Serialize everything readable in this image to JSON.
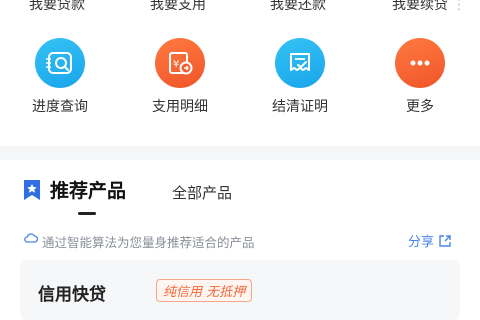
{
  "top_row": [
    "我要贷款",
    "我要支用",
    "我要还款",
    "我要续贷"
  ],
  "grid": [
    {
      "label": "进度查询",
      "icon": "progress-search-icon",
      "color": "#1fa9ee"
    },
    {
      "label": "支用明细",
      "icon": "bill-detail-icon",
      "color": "#f45e2f"
    },
    {
      "label": "结清证明",
      "icon": "settlement-certificate-icon",
      "color": "#1fa9ee"
    },
    {
      "label": "更多",
      "icon": "more-icon",
      "color": "#f45e2f"
    }
  ],
  "tabs": {
    "active": "推荐产品",
    "other": "全部产品"
  },
  "recommendation": {
    "text": "通过智能算法为您量身推荐适合的产品",
    "share": "分享"
  },
  "product": {
    "name": "信用快贷",
    "badge": "纯信用 无抵押"
  }
}
